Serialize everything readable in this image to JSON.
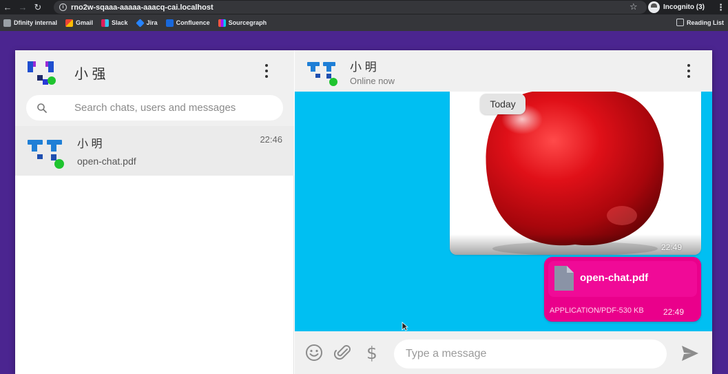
{
  "browser": {
    "url": "rno2w-sqaaa-aaaaa-aaacq-cai.localhost",
    "profile_label": "Incognito (3)",
    "bookmarks": [
      "Dfinity internal",
      "Gmail",
      "Slack",
      "Jira",
      "Confluence",
      "Sourcegraph"
    ],
    "reading_list": "Reading List"
  },
  "sidebar": {
    "user_name": "小 强",
    "search_placeholder": "Search chats, users and messages",
    "chats": [
      {
        "name": "小 明",
        "time": "22:46",
        "preview": "open-chat.pdf"
      }
    ]
  },
  "conversation": {
    "peer_name": "小 明",
    "peer_status": "Online now",
    "date_divider": "Today",
    "messages": [
      {
        "kind": "image",
        "description_icon": "apple-photo",
        "time": "22:49"
      },
      {
        "kind": "file",
        "file_name": "open-chat.pdf",
        "meta": "APPLICATION/PDF-530 KB",
        "time": "22:49"
      }
    ],
    "composer_placeholder": "Type a message"
  },
  "colors": {
    "page_background": "#4b2590",
    "chat_background": "#00bff2",
    "file_bubble": "#ea008b",
    "online_dot": "#1fc42f",
    "avatar_blue": "#1f7fd6"
  }
}
